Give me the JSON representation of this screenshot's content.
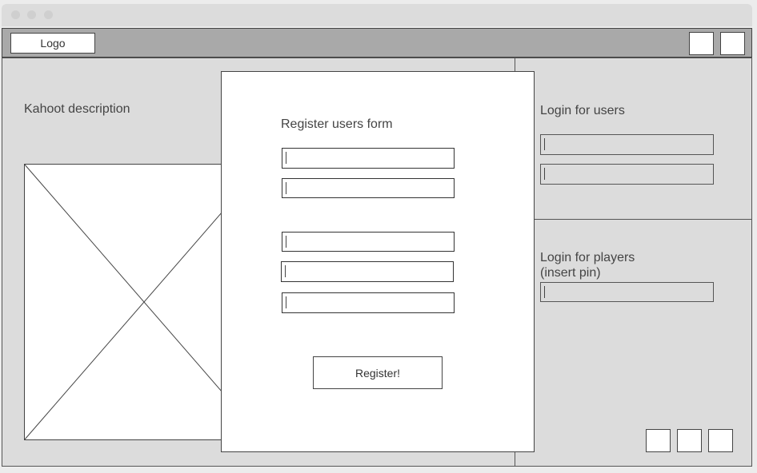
{
  "header": {
    "logo_label": "Logo"
  },
  "main": {
    "description_title": "Kahoot description"
  },
  "register_form": {
    "title": "Register users form",
    "submit_label": "Register!"
  },
  "login_users": {
    "title": "Login for users"
  },
  "login_players": {
    "title_line1": "Login for players",
    "title_line2": "(insert pin)"
  }
}
